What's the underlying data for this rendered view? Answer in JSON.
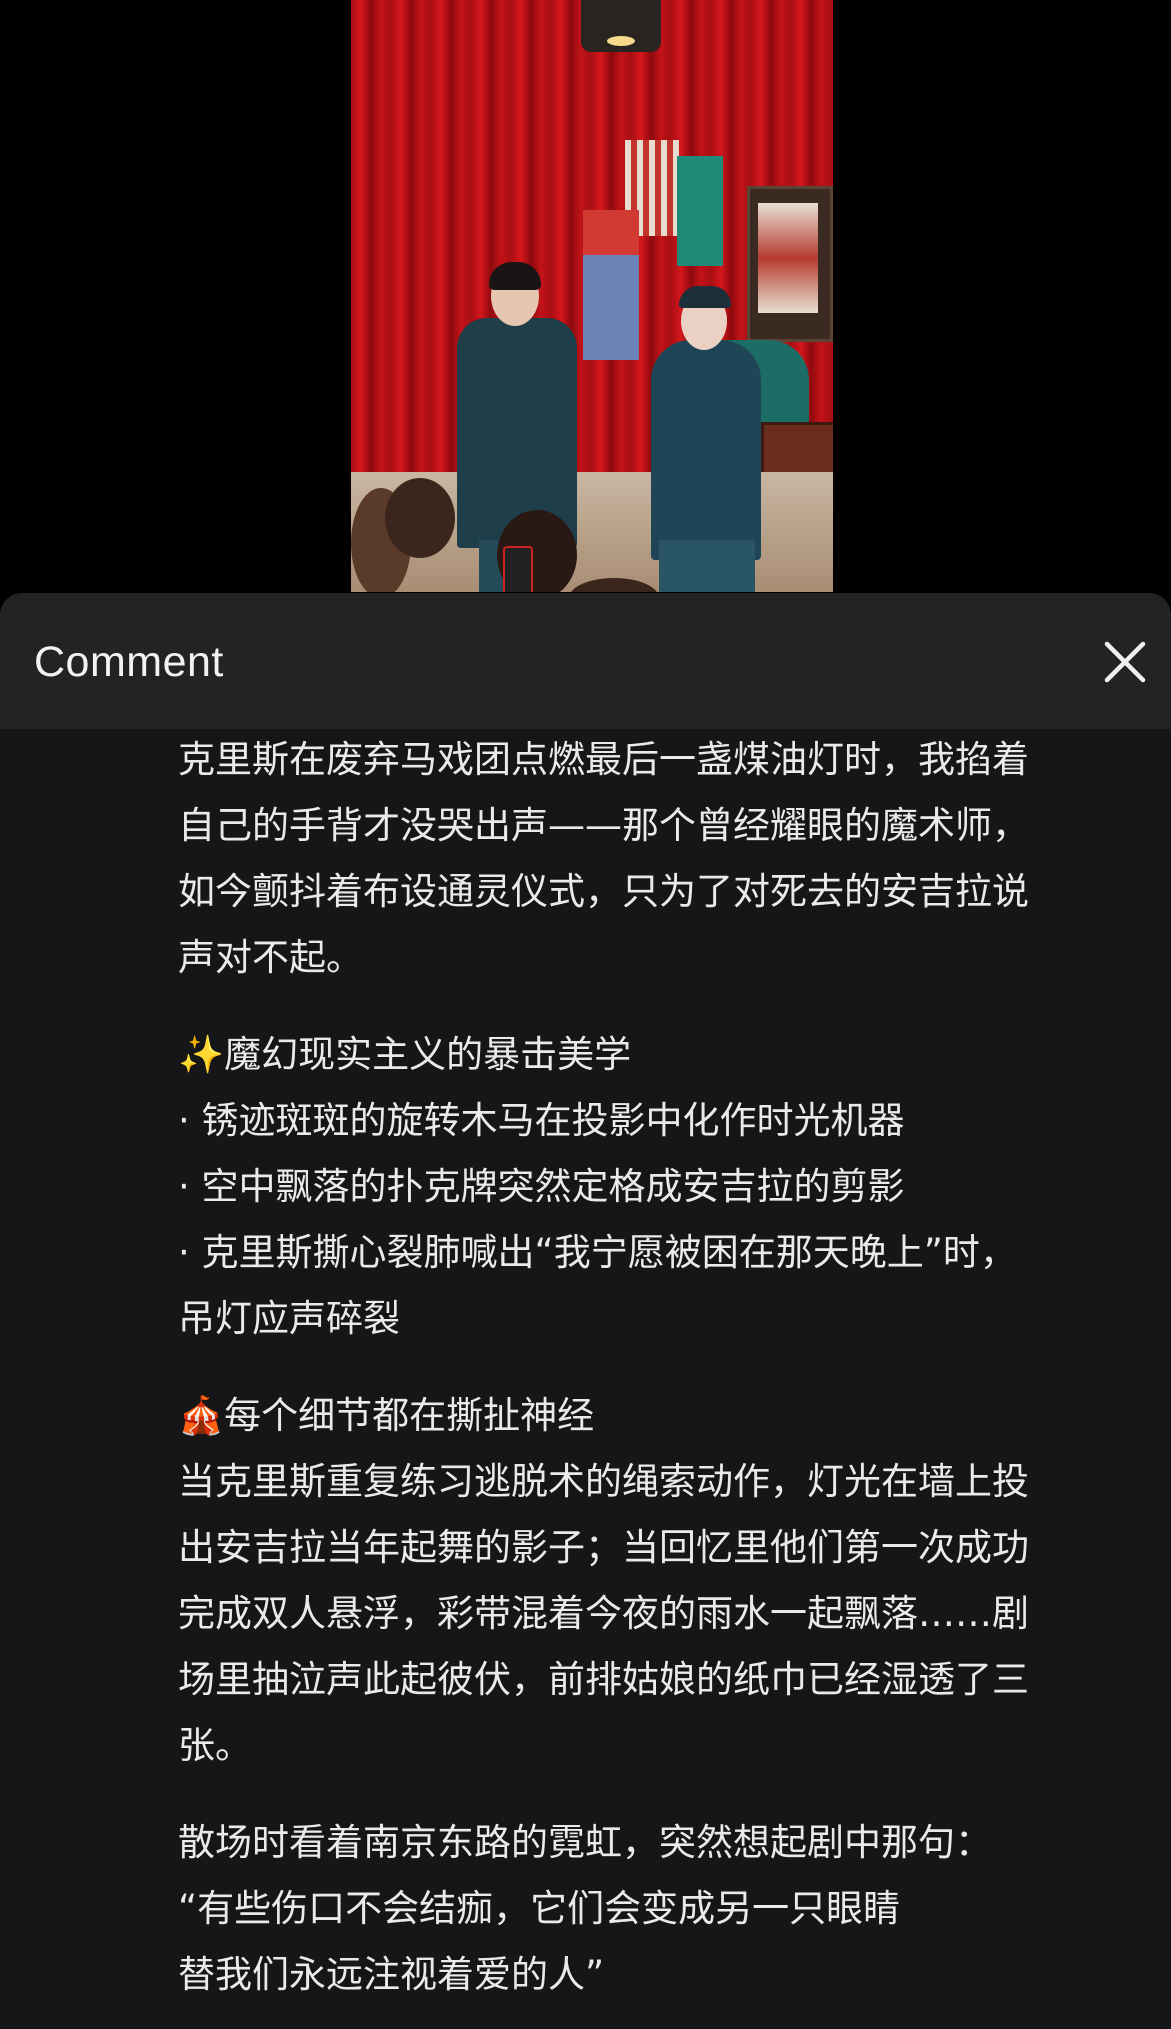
{
  "sheet": {
    "title": "Comment",
    "close_icon": "close-icon"
  },
  "video": {
    "description_icon": "video-thumbnail"
  },
  "comment": {
    "paragraphs": [
      "克里斯在废弃马戏团点燃最后一盏煤油灯时，我掐着\n自己的手背才没哭出声——那个曾经耀眼的魔术师，\n如今颤抖着布设通灵仪式，只为了对死去的安吉拉说\n声对不起。",
      "✨魔幻现实主义的暴击美学\n· 锈迹斑斑的旋转木马在投影中化作时光机器\n· 空中飘落的扑克牌突然定格成安吉拉的剪影\n· 克里斯撕心裂肺喊出“我宁愿被困在那天晚上”时，\n吊灯应声碎裂",
      "🎪每个细节都在撕扯神经\n当克里斯重复练习逃脱术的绳索动作，灯光在墙上投\n出安吉拉当年起舞的影子；当回忆里他们第一次成功\n完成双人悬浮，彩带混着今夜的雨水一起飘落……剧\n场里抽泣声此起彼伏，前排姑娘的纸巾已经湿透了三\n张。",
      "散场时看着南京东路的霓虹，突然想起剧中那句：\n“有些伤口不会结痂，它们会变成另一只眼睛\n替我们永远注视着爱的人”"
    ]
  }
}
